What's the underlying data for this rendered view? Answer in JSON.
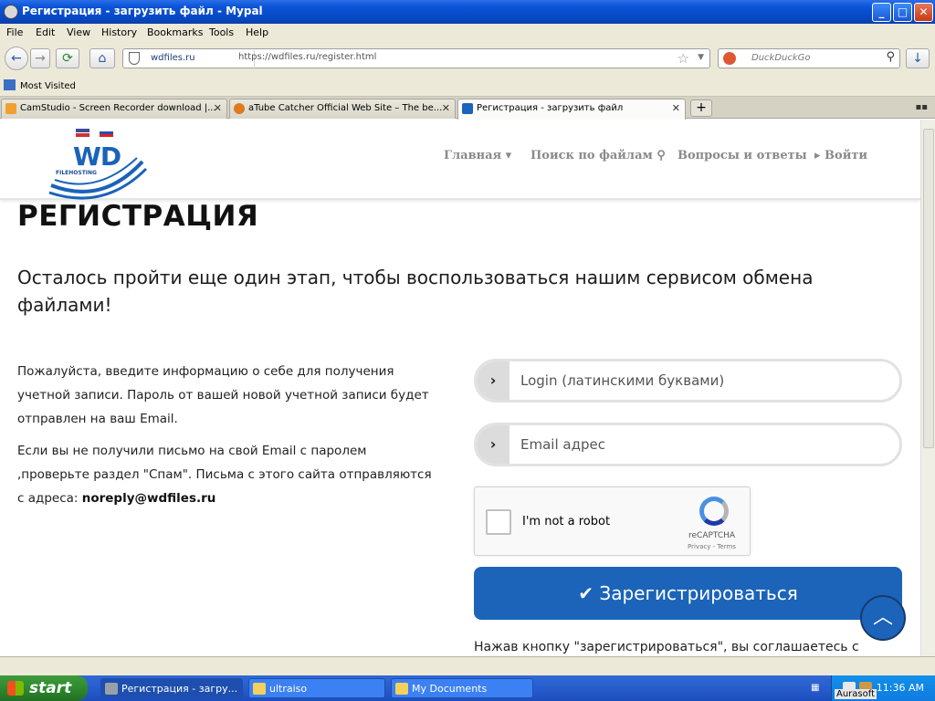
{
  "window": {
    "title": "Регистрация - загрузить файл - Mypal",
    "buttons": {
      "minimize": "_",
      "maximize": "□",
      "close": "✕"
    }
  },
  "menu": [
    "File",
    "Edit",
    "View",
    "History",
    "Bookmarks",
    "Tools",
    "Help"
  ],
  "navbar": {
    "back": "←",
    "forward": "→",
    "reload": "⟳",
    "home": "⌂",
    "identity": "wdfiles.ru",
    "url": "https://wdfiles.ru/register.html",
    "search_placeholder": "DuckDuckGo",
    "download": "↓"
  },
  "bookmarks": [
    "Most Visited"
  ],
  "tabs": [
    {
      "label": "CamStudio - Screen Recorder download |...",
      "icon_color": "#f0a030",
      "active": false
    },
    {
      "label": "aTube Catcher Official Web Site – The be...",
      "icon_color": "#e07a1f",
      "active": false
    },
    {
      "label": "Регистрация - загрузить файл",
      "icon_color": "#1b64b9",
      "active": true
    }
  ],
  "tab_close": "✕",
  "new_tab": "+",
  "site": {
    "logo_text": "WD",
    "logo_sub": "FILEHOSTING",
    "nav": [
      {
        "label": "Главная ▾"
      },
      {
        "label": "Поиск по файлам ⚲"
      },
      {
        "label": "Вопросы и ответы"
      },
      {
        "label": "▸ Войти"
      }
    ]
  },
  "page": {
    "title": "РЕГИСТРАЦИЯ",
    "subtitle": "Осталось пройти еще один этап, чтобы воспользоваться нашим сервисом обмена файлами!",
    "info_1": "Пожалуйста, введите информацию о себе для получения учетной записи. Пароль от вашей новой учетной записи будет отправлен на ваш Email.",
    "info_2_text": "Если вы не получили письмо на свой Email с паролем ,проверьте раздел \"Спам\". Письма с этого сайта отправляются с адреса: ",
    "info_2_email": "noreply@wdfiles.ru",
    "login_placeholder": "Login (латинскими буквами)",
    "email_placeholder": "Email адрес",
    "field_arrow": "›",
    "recaptcha": {
      "label": "I'm not a robot",
      "brand": "reCAPTCHA",
      "terms": "Privacy - Terms"
    },
    "register_button": "✔ Зарегистрироваться",
    "agreement": "Нажав кнопку \"зарегистрироваться\", вы соглашаетесь с",
    "scroll_top": "︿"
  },
  "taskbar": {
    "start": "start",
    "tasks": [
      {
        "label": "Регистрация - загру...",
        "icon_color": "#9aa0a8",
        "active": true
      },
      {
        "label": "ultraiso",
        "icon_color": "#f4d15c",
        "active": false
      },
      {
        "label": "My Documents",
        "icon_color": "#f4d15c",
        "active": false
      }
    ],
    "clock": "11:36 AM",
    "desktop_label": "Aurasoft"
  }
}
